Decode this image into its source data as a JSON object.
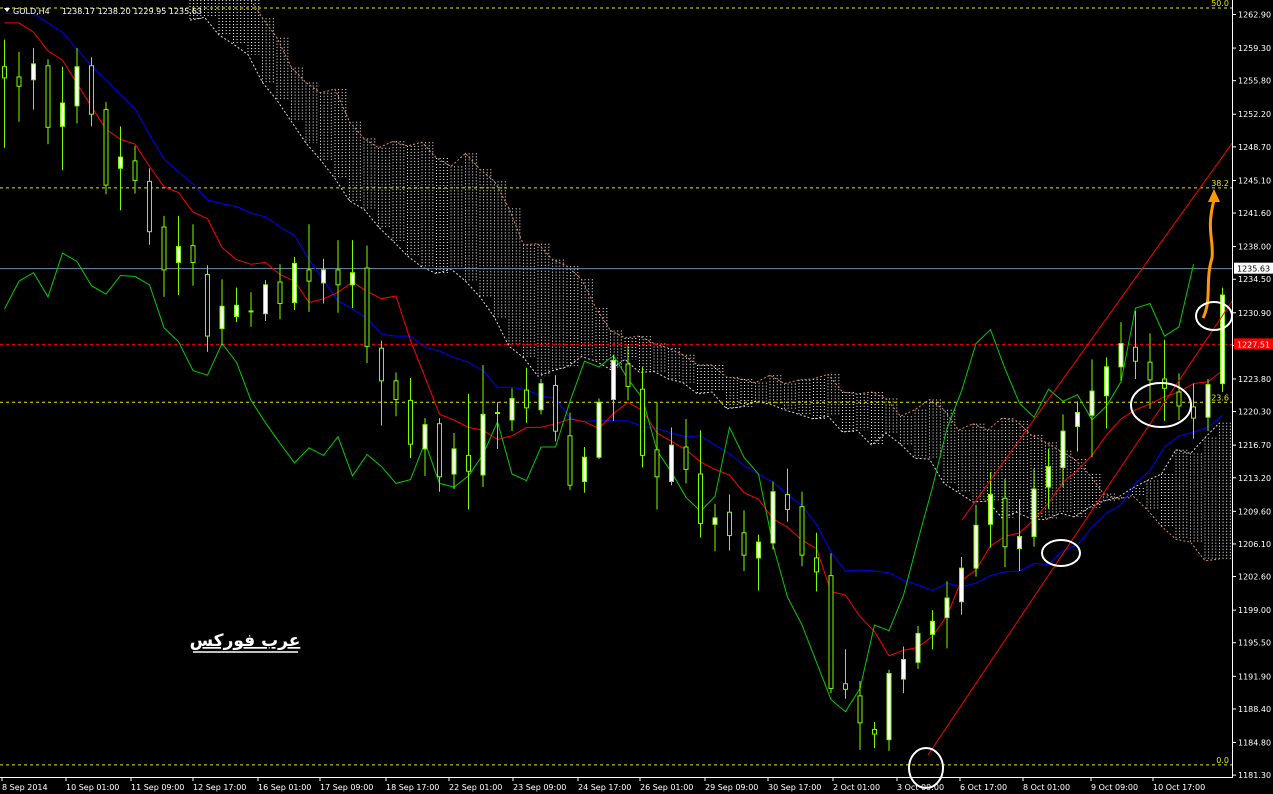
{
  "header": {
    "symbol_label": "GOLD,H4",
    "quotes": "1238.17 1238.20 1229.95 1235.63"
  },
  "watermark": "عرب فوركس",
  "colors": {
    "background": "#000000",
    "candle": "#7cfc00",
    "candle_body": "#ffffff",
    "tenkan": "#ff0000",
    "kijun": "#0000ff",
    "chikou": "#00cc00",
    "cloud": "#ffffff",
    "fibo": "#e8e800",
    "channel": "#ff0000",
    "forecast_arrow": "#ff9900",
    "current_price_line": "#6f8ea8",
    "level_line": "#ff0000",
    "marker": "#ffffff"
  },
  "chart_data": {
    "type": "candlestick",
    "symbol": "GOLD",
    "timeframe": "H4",
    "ylim": [
      1181.0,
      1264.5
    ],
    "y_ticks": [
      "1262.90",
      "1259.30",
      "1255.80",
      "1252.20",
      "1248.70",
      "1245.10",
      "1241.60",
      "1238.00",
      "1234.50",
      "1230.90",
      "1227.40",
      "1223.80",
      "1220.30",
      "1216.70",
      "1213.20",
      "1209.60",
      "1206.10",
      "1202.60",
      "1199.00",
      "1195.50",
      "1191.90",
      "1188.40",
      "1184.80",
      "1181.30"
    ],
    "y_tick_values": [
      1262.9,
      1259.3,
      1255.8,
      1252.2,
      1248.7,
      1245.1,
      1241.6,
      1238.0,
      1234.5,
      1230.9,
      1227.4,
      1223.8,
      1220.3,
      1216.7,
      1213.2,
      1209.6,
      1206.1,
      1202.6,
      1199.0,
      1195.5,
      1191.9,
      1188.4,
      1184.8,
      1181.3
    ],
    "x_ticks": [
      "8 Sep 2014",
      "10 Sep 01:00",
      "11 Sep 09:00",
      "12 Sep 17:00",
      "16 Sep 01:00",
      "17 Sep 09:00",
      "18 Sep 17:00",
      "22 Sep 01:00",
      "23 Sep 09:00",
      "24 Sep 17:00",
      "26 Sep 01:00",
      "29 Sep 09:00",
      "30 Sep 17:00",
      "2 Oct 01:00",
      "3 Oct 09:00",
      "6 Oct 17:00",
      "8 Oct 01:00",
      "9 Oct 09:00",
      "10 Oct 17:00"
    ],
    "x_tick_bars": [
      0,
      8,
      16,
      24,
      32,
      40,
      48,
      56,
      64,
      72,
      80,
      88,
      96,
      104,
      112,
      120,
      128,
      136,
      144
    ],
    "current_price": "1235.63",
    "current_price_value": 1235.63,
    "red_level": "1227.51",
    "red_level_value": 1227.51,
    "fibo_levels": [
      {
        "label": "38.2",
        "value": 1244.3
      },
      {
        "label": "23.6",
        "value": 1221.3
      },
      {
        "label": "0.0",
        "value": 1182.4
      },
      {
        "label": "50.0",
        "value": 1263.6
      }
    ],
    "ohlc": [
      [
        1257.3,
        1260.2,
        1248.6,
        1256.1
      ],
      [
        1256.2,
        1258.9,
        1251.4,
        1255.2
      ],
      [
        1255.9,
        1259.3,
        1252.7,
        1257.6
      ],
      [
        1257.4,
        1258.1,
        1249.0,
        1250.8
      ],
      [
        1250.9,
        1257.3,
        1246.2,
        1253.4
      ],
      [
        1253.1,
        1259.3,
        1251.2,
        1257.3
      ],
      [
        1257.4,
        1258.3,
        1250.9,
        1252.2
      ],
      [
        1252.7,
        1253.5,
        1243.6,
        1244.6
      ],
      [
        1246.4,
        1250.9,
        1241.9,
        1247.6
      ],
      [
        1247.2,
        1248.8,
        1243.7,
        1245.1
      ],
      [
        1245.0,
        1246.4,
        1238.2,
        1239.6
      ],
      [
        1240.1,
        1241.3,
        1232.6,
        1235.5
      ],
      [
        1236.3,
        1241.3,
        1232.8,
        1238.0
      ],
      [
        1238.1,
        1240.4,
        1233.8,
        1236.3
      ],
      [
        1235.0,
        1236.0,
        1226.7,
        1228.4
      ],
      [
        1229.2,
        1234.5,
        1227.4,
        1231.6
      ],
      [
        1230.5,
        1233.6,
        1229.9,
        1231.7
      ],
      [
        1231.1,
        1233.1,
        1229.4,
        1231.0
      ],
      [
        1230.8,
        1234.4,
        1230.0,
        1233.9
      ],
      [
        1234.2,
        1236.1,
        1230.2,
        1231.9
      ],
      [
        1232.0,
        1236.9,
        1231.2,
        1236.2
      ],
      [
        1235.5,
        1240.4,
        1231.0,
        1234.3
      ],
      [
        1234.1,
        1236.7,
        1231.9,
        1235.5
      ],
      [
        1235.5,
        1238.7,
        1230.9,
        1233.9
      ],
      [
        1233.9,
        1238.7,
        1231.4,
        1235.2
      ],
      [
        1235.7,
        1238.1,
        1225.5,
        1227.3
      ],
      [
        1227.1,
        1227.9,
        1218.8,
        1223.6
      ],
      [
        1223.6,
        1224.5,
        1219.8,
        1221.6
      ],
      [
        1221.5,
        1223.9,
        1215.3,
        1216.8
      ],
      [
        1216.3,
        1219.6,
        1213.4,
        1218.9
      ],
      [
        1219.0,
        1219.6,
        1211.7,
        1213.3
      ],
      [
        1213.6,
        1218.0,
        1212.0,
        1216.3
      ],
      [
        1215.6,
        1222.2,
        1209.8,
        1213.9
      ],
      [
        1213.5,
        1225.3,
        1212.2,
        1220.0
      ],
      [
        1220.2,
        1221.3,
        1216.3,
        1220.1
      ],
      [
        1219.4,
        1222.8,
        1218.2,
        1221.7
      ],
      [
        1222.6,
        1225.0,
        1219.1,
        1220.7
      ],
      [
        1220.5,
        1223.8,
        1220.0,
        1223.3
      ],
      [
        1223.1,
        1224.2,
        1217.1,
        1218.2
      ],
      [
        1217.7,
        1220.2,
        1211.9,
        1212.4
      ],
      [
        1212.8,
        1216.5,
        1211.6,
        1215.4
      ],
      [
        1215.4,
        1221.7,
        1215.2,
        1221.3
      ],
      [
        1221.6,
        1226.4,
        1219.3,
        1225.8
      ],
      [
        1225.4,
        1227.4,
        1221.5,
        1223.0
      ],
      [
        1222.7,
        1225.1,
        1214.3,
        1215.6
      ],
      [
        1216.2,
        1221.3,
        1209.8,
        1213.3
      ],
      [
        1212.8,
        1218.6,
        1212.4,
        1216.7
      ],
      [
        1216.5,
        1219.5,
        1212.6,
        1214.1
      ],
      [
        1213.6,
        1218.3,
        1206.8,
        1208.3
      ],
      [
        1208.2,
        1210.4,
        1205.3,
        1208.9
      ],
      [
        1209.5,
        1211.4,
        1205.4,
        1207.0
      ],
      [
        1207.3,
        1209.7,
        1203.2,
        1204.9
      ],
      [
        1204.6,
        1207.1,
        1201.1,
        1206.3
      ],
      [
        1206.2,
        1212.8,
        1205.5,
        1211.7
      ],
      [
        1211.4,
        1214.2,
        1208.5,
        1209.8
      ],
      [
        1210.1,
        1211.7,
        1203.7,
        1204.9
      ],
      [
        1204.6,
        1207.3,
        1201.0,
        1203.1
      ],
      [
        1202.7,
        1205.1,
        1190.1,
        1190.6
      ],
      [
        1191.1,
        1194.8,
        1189.5,
        1190.5
      ],
      [
        1189.8,
        1191.4,
        1184.0,
        1186.9
      ],
      [
        1186.2,
        1187.0,
        1184.2,
        1185.7
      ],
      [
        1185.1,
        1192.6,
        1183.9,
        1192.2
      ],
      [
        1191.6,
        1195.1,
        1190.1,
        1193.7
      ],
      [
        1193.4,
        1197.3,
        1192.7,
        1196.5
      ],
      [
        1196.4,
        1199.0,
        1194.8,
        1197.8
      ],
      [
        1198.2,
        1202.1,
        1194.9,
        1200.3
      ],
      [
        1199.9,
        1204.7,
        1198.5,
        1203.5
      ],
      [
        1203.5,
        1210.3,
        1202.6,
        1208.1
      ],
      [
        1208.2,
        1213.8,
        1205.7,
        1211.4
      ],
      [
        1211.0,
        1213.1,
        1203.6,
        1205.8
      ],
      [
        1205.6,
        1210.9,
        1203.2,
        1206.9
      ],
      [
        1206.9,
        1214.2,
        1205.8,
        1212.0
      ],
      [
        1212.2,
        1216.3,
        1209.9,
        1214.4
      ],
      [
        1214.3,
        1220.0,
        1212.2,
        1218.2
      ],
      [
        1218.7,
        1221.4,
        1216.0,
        1220.2
      ],
      [
        1219.9,
        1225.9,
        1215.4,
        1222.5
      ],
      [
        1222.0,
        1226.1,
        1218.5,
        1225.1
      ],
      [
        1225.1,
        1229.9,
        1223.6,
        1227.6
      ],
      [
        1227.2,
        1231.1,
        1223.8,
        1225.7
      ],
      [
        1225.6,
        1228.7,
        1220.6,
        1223.7
      ],
      [
        1223.8,
        1228.0,
        1219.3,
        1222.8
      ],
      [
        1222.4,
        1224.4,
        1219.4,
        1220.9
      ],
      [
        1220.8,
        1223.3,
        1217.4,
        1219.6
      ],
      [
        1219.7,
        1223.8,
        1218.2,
        1223.2
      ],
      [
        1223.3,
        1233.6,
        1222.4,
        1232.8
      ],
      [
        1232.7,
        1234.6,
        1227.8,
        1229.2
      ],
      [
        1228.8,
        1237.5,
        1225.8,
        1233.8
      ],
      [
        1233.4,
        1236.8,
        1229.9,
        1231.7
      ],
      [
        1231.8,
        1235.8,
        1230.0,
        1235.6
      ]
    ],
    "tenkan": [
      1262.0,
      1262.0,
      1261.0,
      1259.0,
      1258.0,
      1255.5,
      1253.0,
      1250.6,
      1249.5,
      1249.0,
      1246.6,
      1244.4,
      1243.8,
      1241.7,
      1241.0,
      1237.9,
      1236.6,
      1236.1,
      1236.3,
      1235.0,
      1234.3,
      1232.0,
      1232.4,
      1233.1,
      1234.2,
      1233.2,
      1232.4,
      1232.7,
      1227.9,
      1224.0,
      1220.0,
      1219.4,
      1218.6,
      1218.3,
      1217.3,
      1217.7,
      1218.6,
      1218.6,
      1219.0,
      1219.5,
      1219.2,
      1218.5,
      1220.1,
      1221.3,
      1220.4,
      1218.0,
      1217.1,
      1216.2,
      1214.9,
      1214.1,
      1213.5,
      1211.6,
      1210.9,
      1208.8,
      1207.9,
      1206.5,
      1205.6,
      1201.0,
      1200.6,
      1198.3,
      1196.7,
      1194.1,
      1194.7,
      1195.0,
      1196.2,
      1198.4,
      1202.2,
      1203.3,
      1205.9,
      1206.9,
      1207.3,
      1208.7,
      1210.5,
      1212.7,
      1214.0,
      1215.6,
      1217.8,
      1219.5,
      1220.5,
      1221.1,
      1221.9,
      1222.4,
      1223.3,
      1223.5,
      1224.7,
      1226.5,
      1228.4,
      1229.4,
      1230.2
    ],
    "kijun": [
      1263.0,
      1263.0,
      1263.0,
      1262.0,
      1261.0,
      1259.2,
      1257.4,
      1255.9,
      1254.3,
      1252.8,
      1250.0,
      1247.4,
      1246.0,
      1244.7,
      1243.0,
      1242.6,
      1242.3,
      1241.6,
      1241.2,
      1240.1,
      1239.2,
      1236.6,
      1234.4,
      1232.2,
      1231.3,
      1230.3,
      1228.6,
      1228.4,
      1228.4,
      1227.2,
      1226.8,
      1226.1,
      1225.6,
      1224.7,
      1222.9,
      1222.9,
      1222.6,
      1222.0,
      1221.7,
      1219.6,
      1219.2,
      1219.4,
      1219.3,
      1219.3,
      1218.7,
      1218.5,
      1218.0,
      1217.6,
      1217.7,
      1216.7,
      1215.8,
      1214.5,
      1213.6,
      1212.7,
      1211.4,
      1210.2,
      1208.2,
      1205.2,
      1203.2,
      1203.3,
      1203.2,
      1203.0,
      1202.2,
      1201.7,
      1201.1,
      1201.9,
      1201.5,
      1201.9,
      1202.7,
      1203.1,
      1203.2,
      1204.0,
      1203.9,
      1205.4,
      1206.0,
      1207.9,
      1209.4,
      1210.3,
      1212.6,
      1214.0,
      1216.5,
      1217.7,
      1218.1,
      1218.6,
      1219.9,
      1221.4,
      1223.1,
      1224.5,
      1225.3
    ],
    "chikou": [
      1231.3,
      1234.3,
      1235.2,
      1232.6,
      1237.3,
      1236.4,
      1233.8,
      1232.9,
      1234.9,
      1234.8,
      1233.9,
      1229.3,
      1227.8,
      1224.7,
      1224.2,
      1227.6,
      1225.6,
      1221.5,
      1219.1,
      1216.9,
      1214.8,
      1216.4,
      1215.6,
      1217.6,
      1213.4,
      1215.7,
      1214.4,
      1212.6,
      1213.0,
      1217.0,
      1212.6,
      1212.2,
      1213.4,
      1215.7,
      1219.2,
      1213.6,
      1212.9,
      1216.5,
      1216.5,
      1221.4,
      1225.7,
      1225.1,
      1226.3,
      1223.8,
      1221.7,
      1216.1,
      1213.8,
      1211.1,
      1209.6,
      1211.2,
      1218.6,
      1215.4,
      1213.6,
      1206.0,
      1200.4,
      1197.4,
      1193.4,
      1189.4,
      1188.1,
      1190.6,
      1197.4,
      1196.8,
      1200.6,
      1206.5,
      1212.2,
      1218.5,
      1222.5,
      1227.6,
      1229.1,
      1224.9,
      1221.2,
      1219.7,
      1222.7,
      1221.4,
      1222.1,
      1219.4,
      1220.9,
      1223.5,
      1231.4,
      1231.9,
      1228.4,
      1229.4,
      1236.1
    ],
    "cloud_span_a": [
      1268.0,
      1268.0,
      1266.9,
      1266.9,
      1264.9,
      1262.5,
      1260.4,
      1257.2,
      1255.6,
      1254.5,
      1254.9,
      1251.4,
      1249.6,
      1248.6,
      1249.3,
      1248.8,
      1249.2,
      1247.5,
      1246.6,
      1248.0,
      1246.3,
      1245.0,
      1242.1,
      1238.2,
      1238.3,
      1236.6,
      1235.9,
      1234.5,
      1231.4,
      1229.0,
      1228.2,
      1228.4,
      1227.6,
      1227.1,
      1226.4,
      1225.3,
      1225.3,
      1224.0,
      1223.8,
      1223.4,
      1224.2,
      1223.3,
      1223.7,
      1223.8,
      1224.3,
      1222.4,
      1222.2,
      1222.4,
      1221.7,
      1219.8,
      1220.5,
      1221.6,
      1220.5,
      1218.3,
      1219.0,
      1218.3,
      1219.6,
      1219.3,
      1217.8,
      1217.0,
      1216.1,
      1215.2,
      1213.6,
      1211.5,
      1210.9,
      1211.3,
      1209.8,
      1208.0,
      1206.6,
      1206.3,
      1204.3,
      1204.5,
      1203.5,
      1202.2,
      1201.4,
      1201.8,
      1201.6,
      1202.4,
      1202.0,
      1200.4,
      1199.2,
      1200.2,
      1200.2,
      1199.8,
      1199.0,
      1198.9,
      1199.6,
      1200.0
    ],
    "cloud_span_b": [
      1262.3,
      1262.6,
      1260.7,
      1259.7,
      1258.6,
      1255.6,
      1253.7,
      1251.4,
      1249.1,
      1247.3,
      1245.3,
      1242.9,
      1242.0,
      1240.1,
      1238.6,
      1237.0,
      1235.8,
      1235.1,
      1235.6,
      1234.3,
      1232.6,
      1230.4,
      1227.3,
      1226.1,
      1224.1,
      1224.7,
      1225.1,
      1226.2,
      1225.7,
      1224.8,
      1225.9,
      1224.5,
      1224.6,
      1223.8,
      1223.4,
      1222.2,
      1222.4,
      1220.6,
      1220.8,
      1221.4,
      1221.1,
      1220.5,
      1220.0,
      1219.5,
      1219.8,
      1218.1,
      1218.3,
      1216.7,
      1218.0,
      1216.8,
      1215.3,
      1215.2,
      1212.6,
      1211.6,
      1210.6,
      1210.7,
      1208.9,
      1209.5,
      1208.8,
      1208.7,
      1209.4,
      1209.0,
      1210.0,
      1210.7,
      1211.1,
      1212.1,
      1212.9,
      1213.6,
      1216.2,
      1215.8,
      1217.5,
      1219.1,
      1218.4,
      1218.6,
      1219.7,
      1222.0,
      1221.9,
      1219.7,
      1217.6,
      1216.2,
      1213.7,
      1212.2,
      1212.4,
      1211.5,
      1208.6,
      1206.9,
      1207.2,
      1206.8
    ]
  }
}
